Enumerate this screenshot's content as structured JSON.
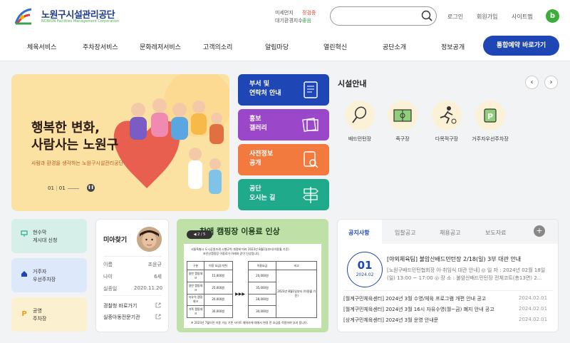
{
  "header": {
    "logo_text": "노원구시설관리공단",
    "logo_sub": "NOWON Facilities Management Corporation",
    "air": {
      "fine_dust_label": "미세먼지",
      "fine_dust_value": "정검중",
      "air_index_label": "대기환경지수",
      "air_index_value": "좋음"
    },
    "search_placeholder": "",
    "top_links": [
      "로그인",
      "회원가입",
      "사이트맵"
    ],
    "profile_letter": "b"
  },
  "nav": {
    "items": [
      "체육서비스",
      "주차장서비스",
      "문화레저서비스",
      "고객의소리",
      "알림마당",
      "열린혁신",
      "공단소개",
      "정보공개"
    ],
    "cta": "통합예약 바로가기"
  },
  "banner": {
    "title_line1": "행복한 변화,",
    "title_line2": "사람사는 노원구",
    "subtitle": "사람과 환경을 생각하는 노원구시설관리공단",
    "page_current": "01",
    "page_total": "01"
  },
  "quick": [
    {
      "line1": "부서 및",
      "line2": "연락처 안내",
      "color": "#1e47b5"
    },
    {
      "line1": "홍보",
      "line2": "갤러리",
      "color": "#9a48c9"
    },
    {
      "line1": "사전정보",
      "line2": "공개",
      "color": "#f27a3e"
    },
    {
      "line1": "공단",
      "line2": "오시는 길",
      "color": "#1faa8c"
    }
  ],
  "facility": {
    "title": "시설안내",
    "items": [
      "배드민턴장",
      "족구장",
      "다목적구장",
      "거주자우선주차장"
    ]
  },
  "cards": [
    {
      "line1": "현수막",
      "line2": "게시대 신청",
      "bg": "#d6efe8"
    },
    {
      "line1": "거주자",
      "line2": "우선주차장",
      "bg": "#dde9fb"
    },
    {
      "line1": "공영",
      "line2": "주차장",
      "bg": "#fbf0cf"
    }
  ],
  "missing": {
    "title": "미아찾기",
    "rows": [
      {
        "label": "이름",
        "value": "조윤규"
      },
      {
        "label": "나이",
        "value": "6세"
      },
      {
        "label": "실종일",
        "value": "2020.11.20"
      }
    ],
    "links": [
      "경찰청 바로가기",
      "실종아동전문기관"
    ]
  },
  "notice_image": {
    "title": "창애 캠핑장 이용료 인상",
    "page": "2 / 5",
    "doc_line1": "서울특별시 도시공원조례 시행규칙 개정에 따라 2023년 8월1일부터(이용월 기준)",
    "doc_line2": "초안산캠핑장 이용료가 아래와 같이 인상됩니다.",
    "table": {
      "headers": [
        "구분",
        "이용 요금(기존)",
        "",
        "이용요금",
        "비고"
      ],
      "rows": [
        [
          "일반 캠핑데크",
          "15,000원",
          "",
          "20,000원",
          ""
        ],
        [
          "일반 캠핑데크",
          "25,000원",
          "",
          "35,000원",
          "2023년 8월1일부터 (이용월 기준)"
        ],
        [
          "자유석 캠핑데크",
          "20,000원",
          "",
          "28,000원",
          ""
        ],
        [
          "가족 캠핑데크",
          "30,000원",
          "",
          "30,000원",
          ""
        ]
      ],
      "arrow": "▶▶▶"
    },
    "footer": "※ 2023년 7월이전 이용 가능 기존 사이트 예약자에 대해서 변경 전 요금을 적용하여 부과 합니다."
  },
  "notices": {
    "tabs": [
      "공지사항",
      "입찰공고",
      "채용공고",
      "보도자료"
    ],
    "plus": "+",
    "featured": {
      "day": "01",
      "year_month": "2024.02",
      "title": "[야외체육팀] 불암산배드민턴장 2/18(일) 3부 대관 안내",
      "body": "[노원구배드민턴협회장 아·취임식 대관 안내] ◎ 일 자 : 2024년 02월 18일(일) 13:00 ~ 17:00 ◎ 장 소 : 불암산배드민턴장 전체코트(총13면) 2..."
    },
    "list": [
      {
        "title": "[월계구민체육센터] 2024년 3월 수영/체육 프로그램 개편 안내 공고",
        "date": "2024.02.01"
      },
      {
        "title": "[월계구민체육센터] 2024년 3월 16시 자유수영(월~금) 폐지 안내 공고",
        "date": "2024.02.01"
      },
      {
        "title": "[상계구민체육센터] 2024년 3월 운영 안내문",
        "date": "2024.02.01"
      }
    ]
  }
}
